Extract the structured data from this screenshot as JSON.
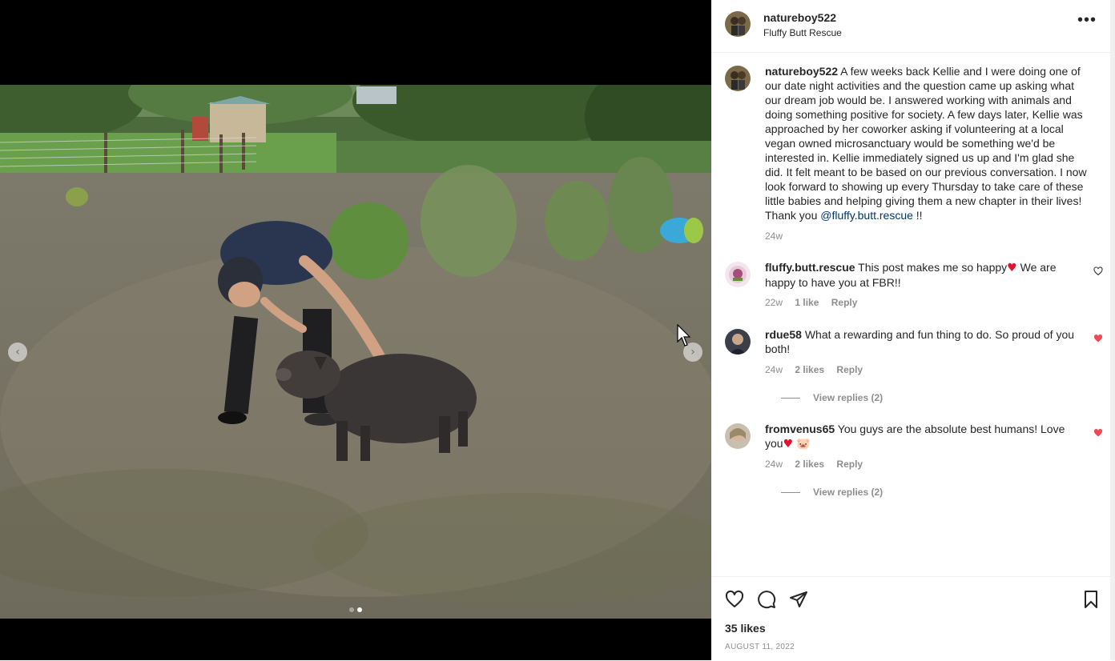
{
  "post": {
    "username": "natureboy522",
    "location": "Fluffy Butt Rescue",
    "more_label": "•••"
  },
  "caption": {
    "username": "natureboy522",
    "text": "A few weeks back Kellie and I were doing one of our date night activities and the question came up asking what our dream job would be. I answered working with animals and doing something positive for society. A few days later, Kellie was approached by her coworker asking if volunteering at a local vegan owned microsanctuary would be something we'd be interested in. Kellie immediately signed us up and I'm glad she did. It felt meant to be based on our previous conversation. I now look forward to showing up every Thursday to take care of these little babies and helping giving them a new chapter in their lives! Thank you",
    "mention": "@fluffy.butt.rescue",
    "suffix": " !!",
    "time": "24w"
  },
  "comments": [
    {
      "username": "fluffy.butt.rescue",
      "text_before": "This post makes me so happy",
      "emoji": "♥",
      "text_after": " We are happy to have you at FBR!!",
      "time": "22w",
      "likes": "1 like",
      "reply": "Reply",
      "liked": false
    },
    {
      "username": "rdue58",
      "text": "What a rewarding and fun thing to do. So proud of you both!",
      "time": "24w",
      "likes": "2 likes",
      "reply": "Reply",
      "view_replies": "View replies (2)",
      "liked": true
    },
    {
      "username": "fromvenus65",
      "text_before": "You guys are the absolute best humans! Love you",
      "emoji": "♥",
      "emoji2": "🐷",
      "time": "24w",
      "likes": "2 likes",
      "reply": "Reply",
      "view_replies": "View replies (2)",
      "liked": true
    }
  ],
  "footer": {
    "likes": "35 likes",
    "date": "AUGUST 11, 2022"
  },
  "carousel": {
    "prev": "‹",
    "next": "›",
    "active_index": 1,
    "count": 2
  },
  "colors": {
    "heart_red": "#ed4956",
    "mention": "#00376b",
    "meta_gray": "#8e8e8e"
  },
  "icons": {
    "like": "heart-icon",
    "comment": "comment-icon",
    "share": "paper-plane-icon",
    "save": "bookmark-icon"
  }
}
